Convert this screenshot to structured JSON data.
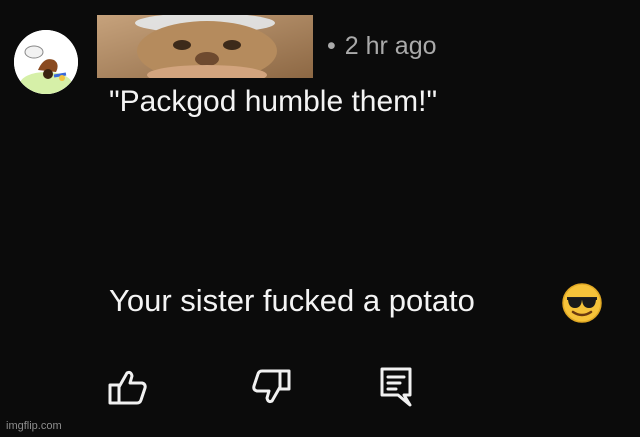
{
  "comment": {
    "timestamp_separator": "•",
    "timestamp": "2 hr ago",
    "quote_text": "\"Packgod humble them!\"",
    "reply_text": "Your sister fucked a potato",
    "emoji_icon": "smiling-face-with-sunglasses-icon"
  },
  "actions": {
    "like_icon": "thumbs-up-icon",
    "dislike_icon": "thumbs-down-icon",
    "reply_icon": "reply-comment-icon"
  },
  "watermark": "imgflip.com",
  "colors": {
    "background": "#0b0b0b",
    "text": "#f4f4f4",
    "meta_text": "#aaaaaa",
    "emoji_yellow": "#f6c33a"
  }
}
